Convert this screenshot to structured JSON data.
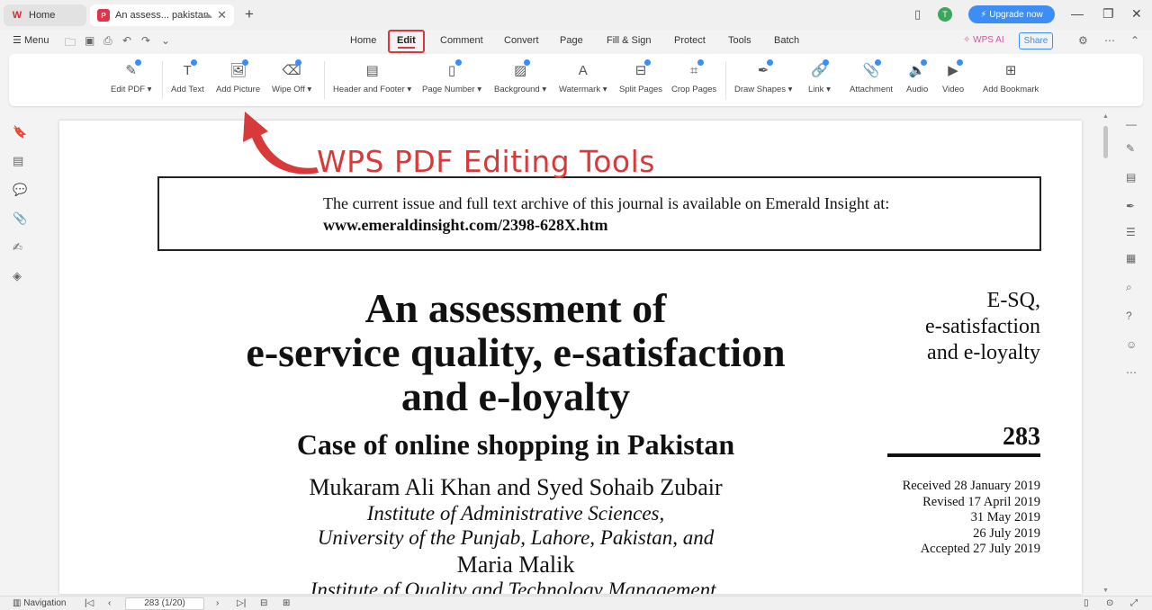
{
  "tabs": {
    "home_label": "Home",
    "doc_label": "An assess... pakistan",
    "new_tab": "+"
  },
  "window": {
    "avatar_letter": "T",
    "upgrade_label": "Upgrade now"
  },
  "menubar": {
    "menu_label": "Menu",
    "tabs": [
      "Home",
      "Edit",
      "Comment",
      "Convert",
      "Page",
      "Fill & Sign",
      "Protect",
      "Tools",
      "Batch"
    ],
    "active_tab": "Edit",
    "wps_ai": "WPS AI",
    "share": "Share"
  },
  "ribbon": {
    "tools": [
      "Edit PDF",
      "Add Text",
      "Add Picture",
      "Wipe Off",
      "Header and Footer",
      "Page Number",
      "Background",
      "Watermark",
      "Split Pages",
      "Crop Pages",
      "Draw Shapes",
      "Link",
      "Attachment",
      "Audio",
      "Video",
      "Add Bookmark"
    ]
  },
  "annotation": {
    "text": "WPS PDF Editing Tools",
    "color": "#d83a3a"
  },
  "document": {
    "archive_line1": "The current issue and full text archive of this journal is available on Emerald Insight at:",
    "archive_line2": "www.emeraldinsight.com/2398-628X.htm",
    "title_line1": "An assessment of",
    "title_line2": "e-service quality, e-satisfaction",
    "title_line3": "and e-loyalty",
    "subtitle": "Case of online shopping in Pakistan",
    "authors": "Mukaram Ali Khan and Syed Sohaib Zubair",
    "affil1": "Institute of Administrative Sciences,",
    "affil2": "University of the Punjab, Lahore, Pakistan, and",
    "author2": "Maria Malik",
    "affil3": "Institute of Quality and Technology Management,",
    "side_heading_l1": "E-SQ,",
    "side_heading_l2": "e-satisfaction",
    "side_heading_l3": "and e-loyalty",
    "page_number": "283",
    "dates": [
      "Received 28 January 2019",
      "Revised 17 April 2019",
      "31 May 2019",
      "26 July 2019",
      "Accepted 27 July 2019"
    ]
  },
  "statusbar": {
    "navigation": "Navigation",
    "page_indicator": "283 (1/20)"
  },
  "colors": {
    "accent_blue": "#3c8df5",
    "active_tab_red": "#d9363e"
  }
}
